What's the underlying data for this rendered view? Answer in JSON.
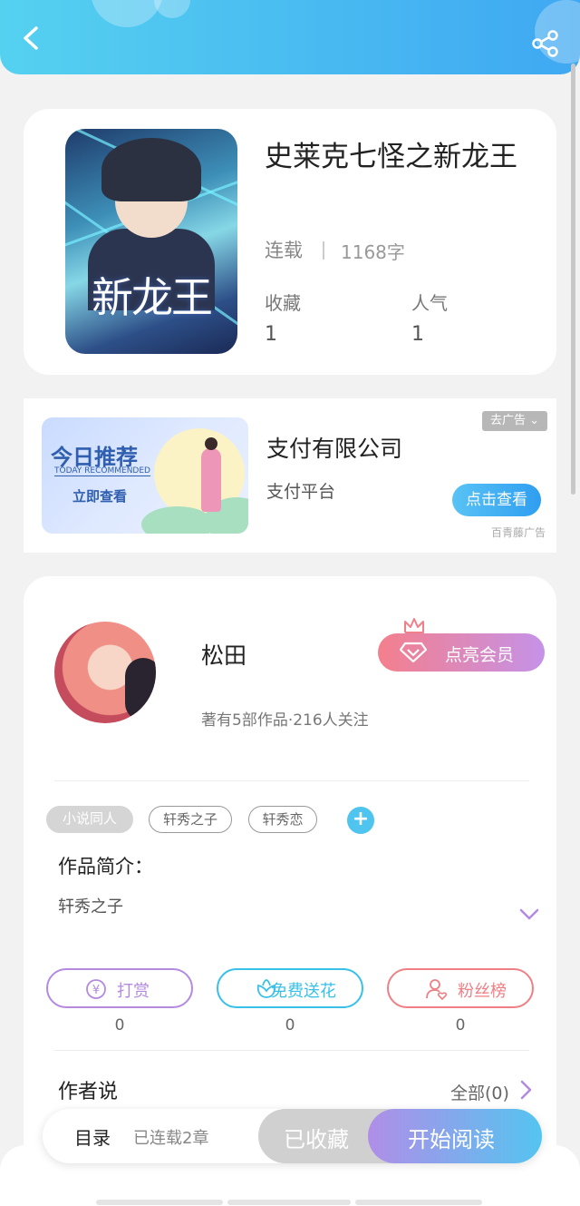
{
  "header": {
    "back_icon": "chevron-left-icon",
    "share_icon": "share-icon",
    "gradient": [
      "#55d1f0",
      "#3fa8f2"
    ]
  },
  "book": {
    "cover_text": "新龙王",
    "title": "史莱克七怪之新龙王",
    "status": "连载",
    "word_count": "1168字",
    "favorites_label": "收藏",
    "favorites_value": "1",
    "popularity_label": "人气",
    "popularity_value": "1"
  },
  "ad": {
    "image_heading": "今日推荐",
    "image_subheading": "TODAY RECOMMENDED",
    "image_cta": "立即查看",
    "title": "支付有限公司",
    "subtitle": "支付平台",
    "remove_label": "去广告",
    "button_label": "点击查看",
    "brand": "百青藤广告"
  },
  "author": {
    "name": "松田",
    "vip_label": "点亮会员",
    "meta": "著有5部作品·216人关注",
    "tags": [
      "小说同人",
      "轩秀之子",
      "轩秀恋"
    ],
    "add_tag": "+",
    "intro_title": "作品简介：",
    "intro_text": "轩秀之子"
  },
  "actions": [
    {
      "label": "打赏",
      "count": "0",
      "color": "#b38ae0",
      "icon": "yen-coin-icon"
    },
    {
      "label": "免费送花",
      "count": "0",
      "color": "#38c0e8",
      "icon": "flower-icon"
    },
    {
      "label": "粉丝榜",
      "count": "0",
      "color": "#ee7f85",
      "icon": "fan-user-icon"
    }
  ],
  "author_says": {
    "title": "作者说",
    "all_label": "全部(0)"
  },
  "bottom_bar": {
    "toc_label": "目录",
    "chapters_label": "已连载2章",
    "favorited_label": "已收藏",
    "read_label": "开始阅读"
  }
}
